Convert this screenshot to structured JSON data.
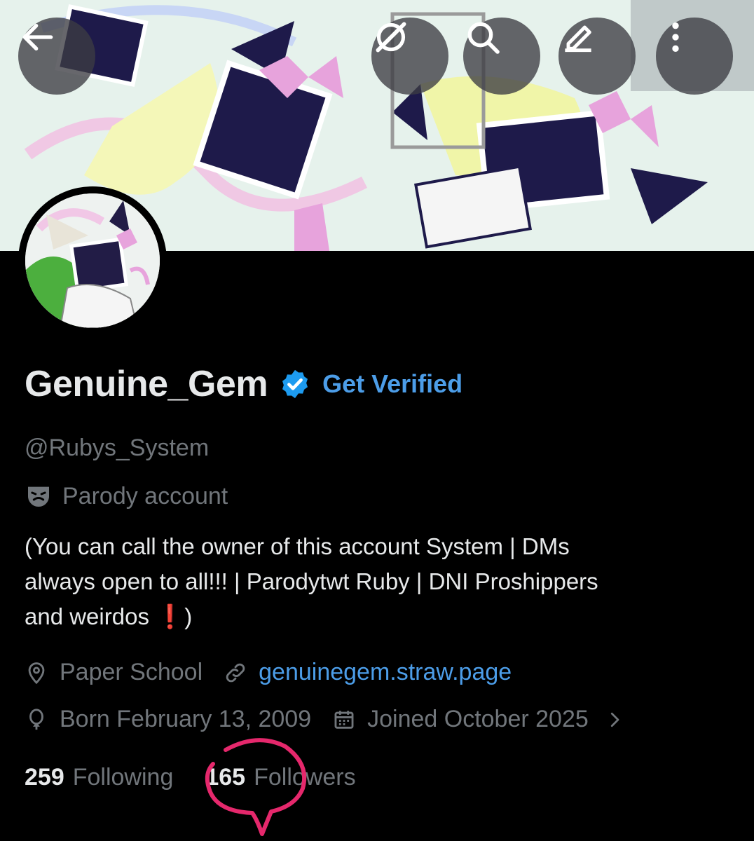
{
  "header": {
    "buttons": [
      {
        "name": "back-button",
        "icon": "arrow-left-icon"
      },
      {
        "name": "grok-button",
        "icon": "grok-icon"
      },
      {
        "name": "search-button",
        "icon": "search-icon"
      },
      {
        "name": "edit-button",
        "icon": "pencil-icon"
      },
      {
        "name": "more-button",
        "icon": "more-vertical-icon"
      }
    ]
  },
  "profile": {
    "display_name": "Genuine_Gem",
    "get_verified_label": "Get Verified",
    "handle": "@Rubys_System",
    "parody_label": "Parody account",
    "bio_line1": "(You can call the owner of this account System | DMs",
    "bio_line2": "always open to all!!! | Parodytwt Ruby | DNI Proshippers",
    "bio_line3_pre": "and weirdos ",
    "bio_excl": "❗",
    "bio_line3_post": ")",
    "location": "Paper School",
    "website": "genuinegem.straw.page",
    "birthday": "Born February 13, 2009",
    "joined": "Joined October 2025"
  },
  "stats": {
    "following_count": "259",
    "following_label": "Following",
    "followers_count": "165",
    "followers_label": "Followers"
  },
  "colors": {
    "background": "#000000",
    "text_primary": "#e7e9ea",
    "text_secondary": "#71767b",
    "accent_blue": "#4c9de8",
    "annotation_pink": "#e5286c"
  }
}
